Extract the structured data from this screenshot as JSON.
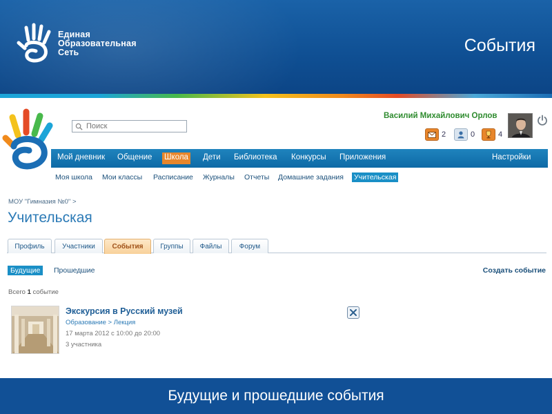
{
  "slide": {
    "brand_lines": [
      "Единая",
      "Образовательная",
      "Сеть"
    ],
    "title": "События",
    "footer": "Будущие и прошедшие события"
  },
  "header": {
    "search_placeholder": "Поиск",
    "user_name": "Василий Михайлович Орлов",
    "notifications": [
      {
        "icon": "mail-icon",
        "count": "2"
      },
      {
        "icon": "people-icon",
        "count": "0"
      },
      {
        "icon": "trophy-icon",
        "count": "4"
      }
    ]
  },
  "nav": {
    "items": [
      "Мой дневник",
      "Общение",
      "Школа",
      "Дети",
      "Библиотека",
      "Конкурсы",
      "Приложения"
    ],
    "active": "Школа",
    "settings": "Настройки"
  },
  "subnav": {
    "items": [
      "Моя школа",
      "Мои классы",
      "Расписание",
      "Журналы",
      "Отчеты",
      "Домашние задания",
      "Учительская"
    ],
    "active": "Учительская"
  },
  "page": {
    "breadcrumb": "МОУ \"Гимназия №0\" >",
    "title": "Учительская",
    "tabs": [
      "Профиль",
      "Участники",
      "События",
      "Группы",
      "Файлы",
      "Форум"
    ],
    "active_tab": "События",
    "filters": [
      "Будущие",
      "Прошедшие"
    ],
    "active_filter": "Будущие",
    "create_event": "Создать событие",
    "count_prefix": "Всего",
    "count_value": "1",
    "count_suffix": "событие"
  },
  "event": {
    "title": "Экскурсия в Русский музей",
    "category": "Образование > Лекция",
    "date": "17 марта 2012 с 10:00 до 20:00",
    "participants": "3 участника"
  },
  "colors": {
    "header_blue": "#115096",
    "nav_blue": "#0e6aa6",
    "accent_orange": "#e8862b",
    "username_green": "#2e8b2e"
  }
}
